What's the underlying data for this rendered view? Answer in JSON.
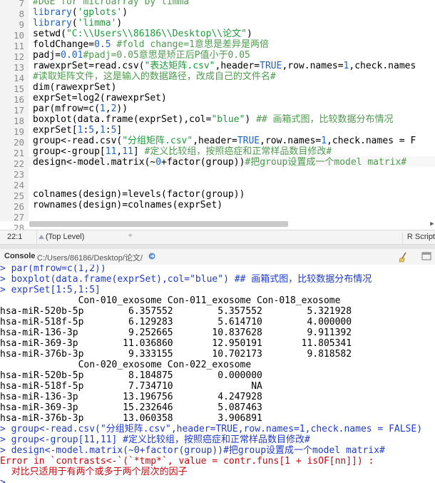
{
  "editor": {
    "lines": [
      {
        "num": "7",
        "parts": [
          {
            "t": "cm",
            "v": "#DGE for microarray by limma"
          }
        ]
      },
      {
        "num": "8",
        "parts": [
          {
            "t": "kw",
            "v": "library"
          },
          {
            "t": "txt",
            "v": "("
          },
          {
            "t": "str",
            "v": "'gplots'"
          },
          {
            "t": "txt",
            "v": ")"
          }
        ]
      },
      {
        "num": "9",
        "parts": [
          {
            "t": "kw",
            "v": "library"
          },
          {
            "t": "txt",
            "v": "("
          },
          {
            "t": "str",
            "v": "'limma'"
          },
          {
            "t": "txt",
            "v": ")"
          }
        ]
      },
      {
        "num": "10",
        "parts": [
          {
            "t": "txt",
            "v": "setwd("
          },
          {
            "t": "str",
            "v": "\"C:\\\\Users\\\\86186\\\\Desktop\\\\论文\""
          },
          {
            "t": "txt",
            "v": ")"
          }
        ]
      },
      {
        "num": "11",
        "parts": [
          {
            "t": "txt",
            "v": "foldChange="
          },
          {
            "t": "num",
            "v": "0.5"
          },
          {
            "t": "txt",
            "v": " "
          },
          {
            "t": "cm",
            "v": "#fold change=1意思是差异是两倍"
          }
        ]
      },
      {
        "num": "12",
        "parts": [
          {
            "t": "txt",
            "v": "padj="
          },
          {
            "t": "num",
            "v": "0.01"
          },
          {
            "t": "cm",
            "v": "#padj=0.05意思是矫正后P值小于0.05"
          }
        ]
      },
      {
        "num": "13",
        "parts": [
          {
            "t": "txt",
            "v": "rawexprSet=read.csv("
          },
          {
            "t": "str",
            "v": "\"表达矩阵.csv\""
          },
          {
            "t": "txt",
            "v": ",header="
          },
          {
            "t": "kw",
            "v": "TRUE"
          },
          {
            "t": "txt",
            "v": ",row.names="
          },
          {
            "t": "num",
            "v": "1"
          },
          {
            "t": "txt",
            "v": ",check.names"
          }
        ]
      },
      {
        "num": "14",
        "parts": [
          {
            "t": "cm",
            "v": "#读取矩阵文件，这是输入的数据路径，改成自己的文件名#"
          }
        ]
      },
      {
        "num": "15",
        "parts": [
          {
            "t": "txt",
            "v": "dim(rawexprSet)"
          }
        ]
      },
      {
        "num": "16",
        "parts": [
          {
            "t": "txt",
            "v": "exprSet=log2(rawexprSet)"
          }
        ]
      },
      {
        "num": "17",
        "parts": [
          {
            "t": "txt",
            "v": "par(mfrow=c("
          },
          {
            "t": "num",
            "v": "1"
          },
          {
            "t": "txt",
            "v": ","
          },
          {
            "t": "num",
            "v": "2"
          },
          {
            "t": "txt",
            "v": "))"
          }
        ]
      },
      {
        "num": "18",
        "parts": [
          {
            "t": "txt",
            "v": "boxplot(data.frame(exprSet),col="
          },
          {
            "t": "str",
            "v": "\"blue\""
          },
          {
            "t": "txt",
            "v": ") "
          },
          {
            "t": "cm",
            "v": "## 画箱式图，比较数据分布情况"
          }
        ]
      },
      {
        "num": "19",
        "parts": [
          {
            "t": "txt",
            "v": "exprSet["
          },
          {
            "t": "num",
            "v": "1"
          },
          {
            "t": "txt",
            "v": ":"
          },
          {
            "t": "num",
            "v": "5"
          },
          {
            "t": "txt",
            "v": ","
          },
          {
            "t": "num",
            "v": "1"
          },
          {
            "t": "txt",
            "v": ":"
          },
          {
            "t": "num",
            "v": "5"
          },
          {
            "t": "txt",
            "v": "]"
          }
        ]
      },
      {
        "num": "20",
        "parts": [
          {
            "t": "txt",
            "v": "group<-read.csv("
          },
          {
            "t": "str",
            "v": "\"分组矩阵.csv\""
          },
          {
            "t": "txt",
            "v": ",header="
          },
          {
            "t": "kw",
            "v": "TRUE"
          },
          {
            "t": "txt",
            "v": ",row.names="
          },
          {
            "t": "num",
            "v": "1"
          },
          {
            "t": "txt",
            "v": ",check.names = F"
          }
        ]
      },
      {
        "num": "21",
        "parts": [
          {
            "t": "txt",
            "v": "group<-group["
          },
          {
            "t": "num",
            "v": "11"
          },
          {
            "t": "txt",
            "v": ","
          },
          {
            "t": "num",
            "v": "11"
          },
          {
            "t": "txt",
            "v": "] "
          },
          {
            "t": "cm",
            "v": "#定义比较组，按照癌症和正常样品数目修改#"
          }
        ]
      },
      {
        "num": "22",
        "parts": [
          {
            "t": "txt",
            "v": "design<-model.matrix(~"
          },
          {
            "t": "num",
            "v": "0"
          },
          {
            "t": "txt",
            "v": "+factor(group))"
          },
          {
            "t": "cm",
            "v": "#把group设置成一个model matrix#"
          }
        ]
      },
      {
        "num": "23",
        "parts": []
      },
      {
        "num": "24",
        "parts": []
      },
      {
        "num": "25",
        "parts": [
          {
            "t": "txt",
            "v": "colnames(design)=levels(factor(group))"
          }
        ]
      },
      {
        "num": "26",
        "parts": [
          {
            "t": "txt",
            "v": "rownames(design)=colnames(exprSet)"
          }
        ]
      },
      {
        "num": "27",
        "parts": []
      },
      {
        "num": "28",
        "parts": []
      }
    ]
  },
  "statusbar": {
    "position": "22:1",
    "scope": "(Top Level)",
    "scope_caret": "÷",
    "filetype": "R Script"
  },
  "console": {
    "title": "Console",
    "path": "C:/Users/86186/Desktop/论文/",
    "lines": [
      {
        "c": "in",
        "v": "> par(mfrow=c(1,2))"
      },
      {
        "c": "in",
        "v": "> boxplot(data.frame(exprSet),col=\"blue\") ## 画箱式图，比较数据分布情况"
      },
      {
        "c": "in",
        "v": "> exprSet[1:5,1:5]"
      },
      {
        "c": "out",
        "v": "              Con-010_exosome Con-011_exosome Con-018_exosome"
      },
      {
        "c": "out",
        "v": "hsa-miR-520b-5p        6.357552        5.357552        5.321928"
      },
      {
        "c": "out",
        "v": "hsa-miR-518f-5p        6.129283        5.614710        4.000000"
      },
      {
        "c": "out",
        "v": "hsa-miR-136-3p         9.252665       10.837628        9.911392"
      },
      {
        "c": "out",
        "v": "hsa-miR-369-3p        11.036860       12.950191       11.805341"
      },
      {
        "c": "out",
        "v": "hsa-miR-376b-3p        9.333155       10.702173        9.818582"
      },
      {
        "c": "out",
        "v": "              Con-020_exosome Con-022_exosome"
      },
      {
        "c": "out",
        "v": "hsa-miR-520b-5p        8.184875        0.000000"
      },
      {
        "c": "out",
        "v": "hsa-miR-518f-5p        7.734710              NA"
      },
      {
        "c": "out",
        "v": "hsa-miR-136-3p        13.196756        4.247928"
      },
      {
        "c": "out",
        "v": "hsa-miR-369-3p        15.232646        5.087463"
      },
      {
        "c": "out",
        "v": "hsa-miR-376b-3p       13.060358        3.906891"
      },
      {
        "c": "in",
        "v": "> group<-read.csv(\"分组矩阵.csv\",header=TRUE,row.names=1,check.names = FALSE)"
      },
      {
        "c": "in",
        "v": "> group<-group[11,11] #定义比较组，按照癌症和正常样品数目修改#"
      },
      {
        "c": "in",
        "v": "> design<-model.matrix(~0+factor(group))#把group设置成一个model matrix#"
      },
      {
        "c": "err",
        "v": "Error in `contrasts<-`(`*tmp*`, value = contr.funs[1 + isOF[nn]]) :"
      },
      {
        "c": "err",
        "v": "  对比只适用于有两个或多于两个层次的因子"
      },
      {
        "c": "in",
        "v": ">"
      }
    ]
  },
  "colors": {
    "comment": "#4d9b4d",
    "string": "#1d9a3a",
    "keyword": "#1b62c9",
    "console_input": "#1d3bcc",
    "error": "#c5060b"
  }
}
